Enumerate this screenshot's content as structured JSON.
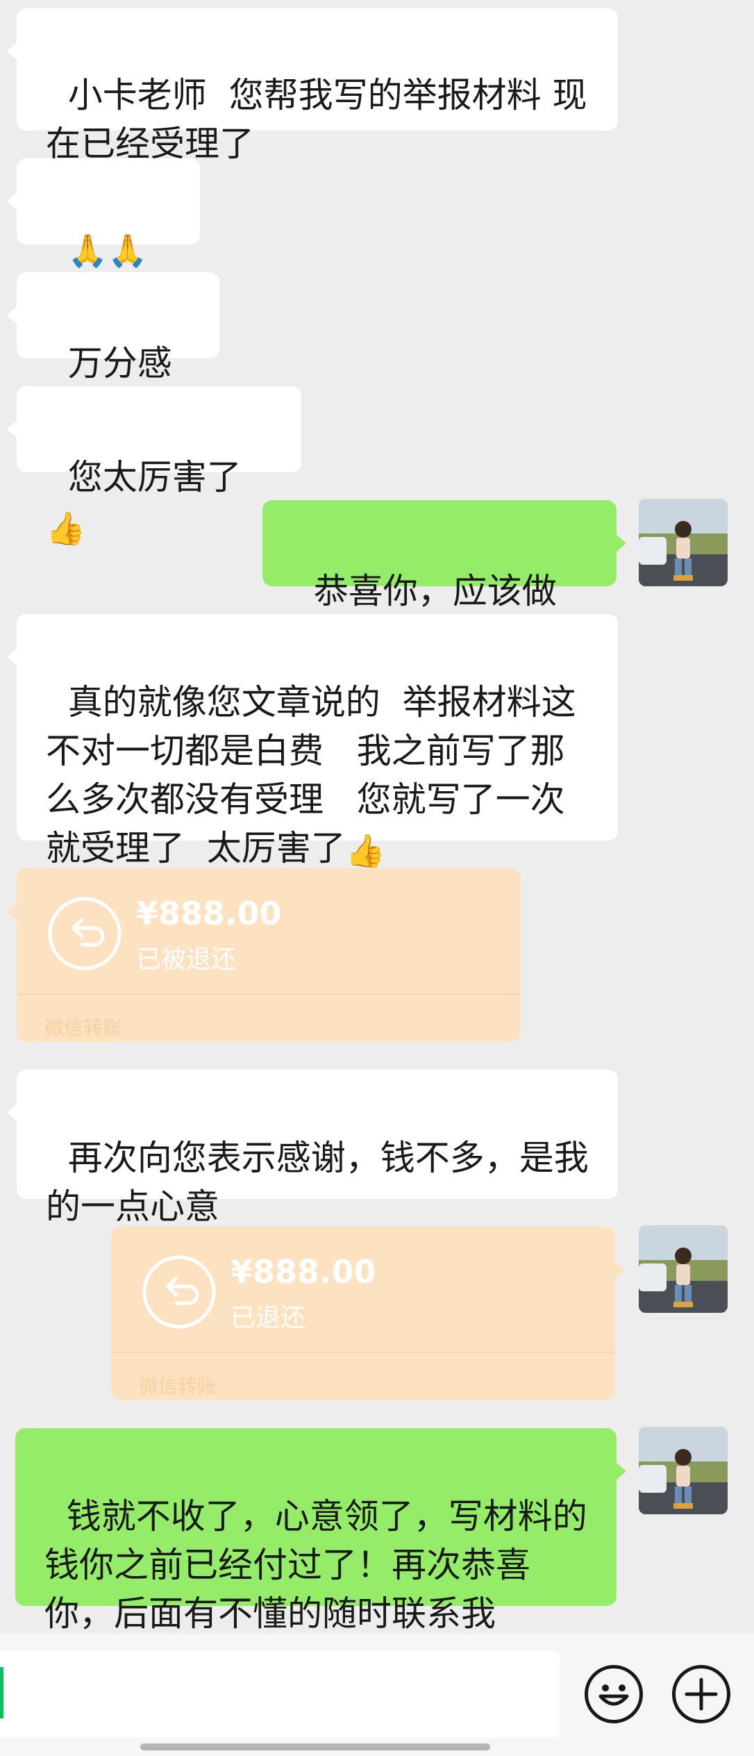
{
  "messages": {
    "m1": "小卡老师  您帮我写的举报材料 现在已经受理了",
    "m2": "🙏🙏🙏",
    "m3": "万分感谢",
    "m4": "您太厉害了",
    "m5": "恭喜你，应该做的",
    "m6": "真的就像您文章说的  举报材料这不对一切都是白费   我之前写了那么多次都没有受理   您就写了一次就受理了  太厉害了",
    "m8": "再次向您表示感谢，钱不多，是我的一点心意",
    "m10": "钱就不收了，心意领了，写材料的钱你之前已经付过了！再次恭喜你，后面有不懂的随时联系我"
  },
  "thumbs_emoji": "👍",
  "transfer_in": {
    "amount": "¥888.00",
    "status": "已被退还",
    "footer": "微信转账"
  },
  "transfer_out": {
    "amount": "¥888.00",
    "status": "已退还",
    "footer": "微信转账"
  },
  "colors": {
    "incoming_bubble": "#ffffff",
    "outgoing_bubble": "#95ec69",
    "transfer": "#fde2c2",
    "background": "#ededed"
  },
  "icons": {
    "avatar": "user-avatar-photo",
    "transfer_icon": "return-arrow-icon",
    "emoji_button": "smiley-icon",
    "more_button": "plus-icon"
  }
}
